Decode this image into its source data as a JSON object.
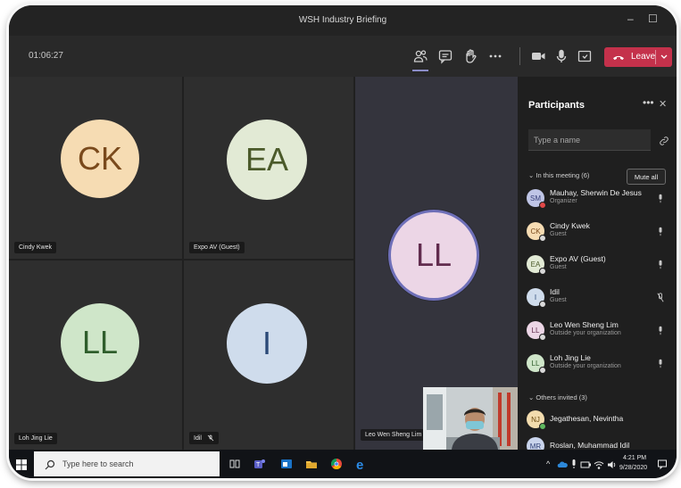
{
  "window": {
    "title": "WSH Industry Briefing",
    "minimize": "–",
    "maximize": "☐"
  },
  "toolbar": {
    "timer": "01:06:27",
    "leave_label": "Leave",
    "icons": [
      "people-icon",
      "chat-icon",
      "raise-hand-icon",
      "more-icon",
      "camera-icon",
      "microphone-icon",
      "share-tray-icon",
      "phone-hangup-icon",
      "chevron-down-icon"
    ]
  },
  "tiles": [
    {
      "initials": "CK",
      "name": "Cindy Kwek",
      "bg": "#f6dcb3",
      "fg": "#7a4a1c",
      "muted": false
    },
    {
      "initials": "EA",
      "name": "Expo AV (Guest)",
      "bg": "#e2ead5",
      "fg": "#4b5a2a",
      "muted": false
    },
    {
      "initials": "LL",
      "name": "Loh Jing Lie",
      "bg": "#cfe6c9",
      "fg": "#2f5e2c",
      "muted": false
    },
    {
      "initials": "I",
      "name": "Idil",
      "bg": "#cfdcec",
      "fg": "#2c4a78",
      "muted": true
    },
    {
      "initials": "LL",
      "name": "Leo Wen Sheng Lim",
      "bg": "#ecd6e6",
      "fg": "#612c4e",
      "muted": false
    }
  ],
  "participants_panel": {
    "title": "Participants",
    "more": "•••",
    "close": "✕",
    "search_placeholder": "Type a name",
    "in_meeting_header": "In this meeting (6)",
    "mute_all_label": "Mute all",
    "in_meeting": [
      {
        "initials": "SM",
        "name": "Mauhay, Sherwin De Jesus",
        "role": "Organizer",
        "bg": "#bfc5e6",
        "fg": "#38407a",
        "status": "#e04848",
        "mic": "on"
      },
      {
        "initials": "CK",
        "name": "Cindy Kwek",
        "role": "Guest",
        "bg": "#f6dcb3",
        "fg": "#7a4a1c",
        "status": "#d9d9d9",
        "mic": "on"
      },
      {
        "initials": "EA",
        "name": "Expo AV (Guest)",
        "role": "Guest",
        "bg": "#e2ead5",
        "fg": "#4b5a2a",
        "status": "#d9d9d9",
        "mic": "on"
      },
      {
        "initials": "I",
        "name": "Idil",
        "role": "Guest",
        "bg": "#cfdcec",
        "fg": "#2c4a78",
        "status": "#d9d9d9",
        "mic": "off"
      },
      {
        "initials": "LL",
        "name": "Leo Wen Sheng Lim",
        "role": "Outside your organization",
        "bg": "#ecd6e6",
        "fg": "#612c4e",
        "status": "#d9d9d9",
        "mic": "on"
      },
      {
        "initials": "LL",
        "name": "Loh Jing Lie",
        "role": "Outside your organization",
        "bg": "#cfe6c9",
        "fg": "#2f5e2c",
        "status": "#d9d9d9",
        "mic": "on"
      }
    ],
    "others_header": "Others invited (3)",
    "others": [
      {
        "initials": "NJ",
        "name": "Jegathesan, Nevintha",
        "bg": "#f2dcae",
        "fg": "#6a4a10",
        "status": "#5fb85f"
      },
      {
        "initials": "MR",
        "name": "Roslan, Muhammad Idil",
        "bg": "#c9d4ec",
        "fg": "#33447a",
        "status": "#5fb85f"
      }
    ]
  },
  "taskbar": {
    "search_placeholder": "Type here to search",
    "time": "4:21 PM",
    "date": "9/28/2020"
  }
}
